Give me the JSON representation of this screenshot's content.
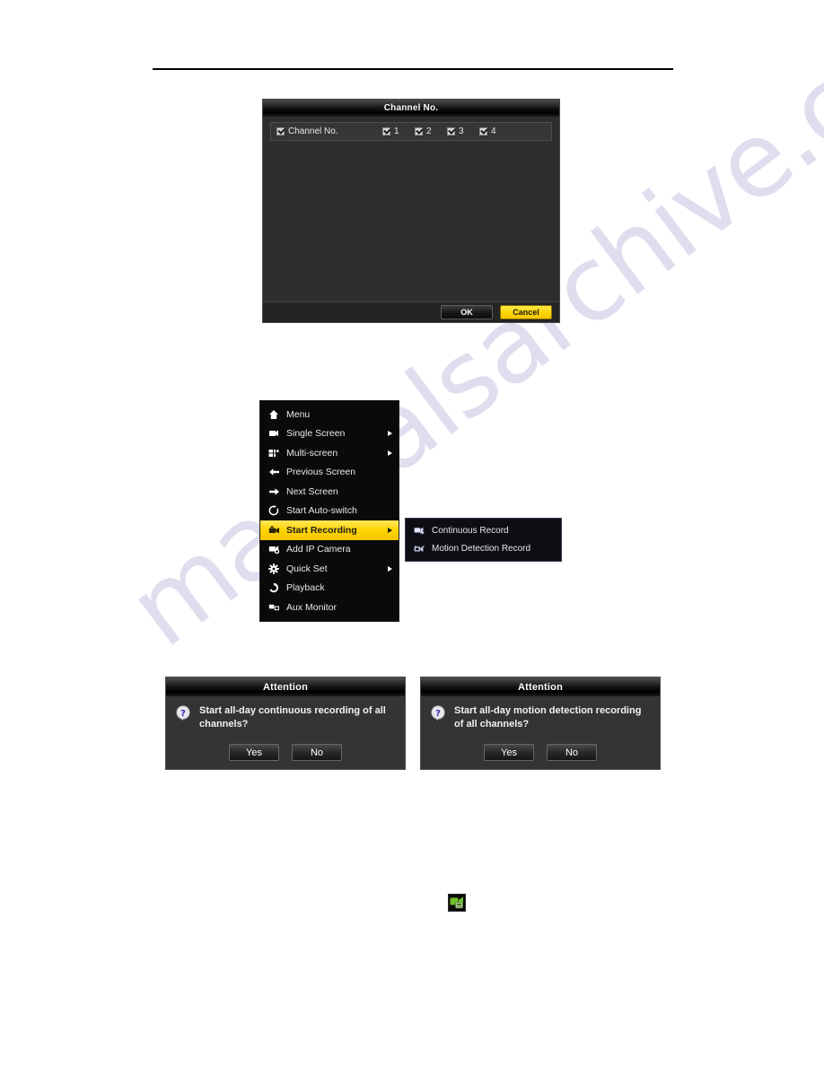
{
  "page": {
    "watermark_text": "manualsarchive.com"
  },
  "channel_dialog": {
    "title": "Channel No.",
    "row_label": "Channel No.",
    "channels": [
      "1",
      "2",
      "3",
      "4"
    ],
    "all_checked": true,
    "buttons": {
      "ok": "OK",
      "cancel": "Cancel"
    },
    "accent_color": "#ffd400"
  },
  "context_menu": {
    "items": [
      {
        "label": "Menu",
        "icon": "home-icon",
        "arrow": false,
        "selected": false
      },
      {
        "label": "Single Screen",
        "icon": "single-screen-icon",
        "arrow": true,
        "selected": false
      },
      {
        "label": "Multi-screen",
        "icon": "multi-screen-icon",
        "arrow": true,
        "selected": false
      },
      {
        "label": "Previous Screen",
        "icon": "arrow-left-icon",
        "arrow": false,
        "selected": false
      },
      {
        "label": "Next Screen",
        "icon": "arrow-right-icon",
        "arrow": false,
        "selected": false
      },
      {
        "label": "Start Auto-switch",
        "icon": "refresh-icon",
        "arrow": false,
        "selected": false
      },
      {
        "label": "Start Recording",
        "icon": "camcorder-icon",
        "arrow": true,
        "selected": true
      },
      {
        "label": "Add IP Camera",
        "icon": "camera-plus-icon",
        "arrow": false,
        "selected": false
      },
      {
        "label": "Quick Set",
        "icon": "gear-icon",
        "arrow": true,
        "selected": false
      },
      {
        "label": "Playback",
        "icon": "playback-icon",
        "arrow": false,
        "selected": false
      },
      {
        "label": "Aux Monitor",
        "icon": "monitor-icon",
        "arrow": false,
        "selected": false
      }
    ],
    "highlight_color": "#ffd500"
  },
  "submenu": {
    "items": [
      {
        "label": "Continuous Record",
        "icon": "continuous-record-icon"
      },
      {
        "label": "Motion Detection Record",
        "icon": "motion-record-icon"
      }
    ]
  },
  "attention_continuous": {
    "title": "Attention",
    "message": "Start all-day continuous recording of all channels?",
    "yes": "Yes",
    "no": "No",
    "icon": "question-icon"
  },
  "attention_motion": {
    "title": "Attention",
    "message": "Start all-day motion detection recording of all channels?",
    "yes": "Yes",
    "no": "No",
    "icon": "question-icon"
  },
  "inline_icon": {
    "name": "record-status-icon"
  }
}
